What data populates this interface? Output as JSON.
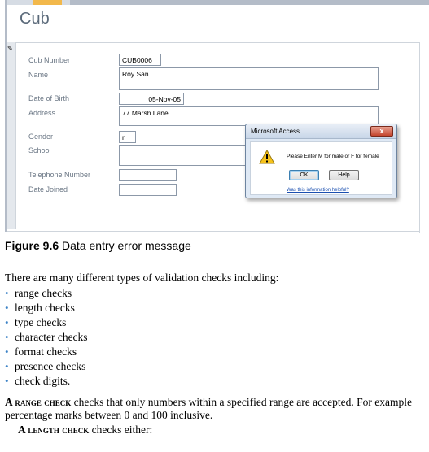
{
  "form": {
    "title": "Cub",
    "fields": [
      {
        "label": "Cub Number",
        "value": "CUB0006"
      },
      {
        "label": "Name",
        "value": "Roy San"
      },
      {
        "label": "Date of Birth",
        "value": "05-Nov-05"
      },
      {
        "label": "Address",
        "value": "77 Marsh Lane"
      },
      {
        "label": "Gender",
        "value": "r"
      },
      {
        "label": "School",
        "value": ""
      },
      {
        "label": "Telephone Number",
        "value": ""
      },
      {
        "label": "Date Joined",
        "value": ""
      }
    ]
  },
  "dialog": {
    "title": "Microsoft Access",
    "close_label": "x",
    "message": "Please Enter M for male or F for female",
    "ok_label": "OK",
    "help_label": "Help",
    "help_link": "Was this information helpful?"
  },
  "document": {
    "caption_number": "Figure 9.6",
    "caption_text": " Data entry error message",
    "intro": "There are many different types of validation checks including:",
    "bullets": [
      "range checks",
      "length checks",
      "type checks",
      "character checks",
      "format checks",
      "presence checks",
      "check digits."
    ],
    "range_check_term": "A range check",
    "range_check_text": " checks that only numbers within a specified range are accepted. For example percentage marks between 0 and 100 inclusive.",
    "length_check_term": "A length check",
    "length_check_text": " checks either:"
  },
  "colors": {
    "bullet": "#3d83c7",
    "link": "#1a4fb0",
    "label": "#6b7785"
  }
}
